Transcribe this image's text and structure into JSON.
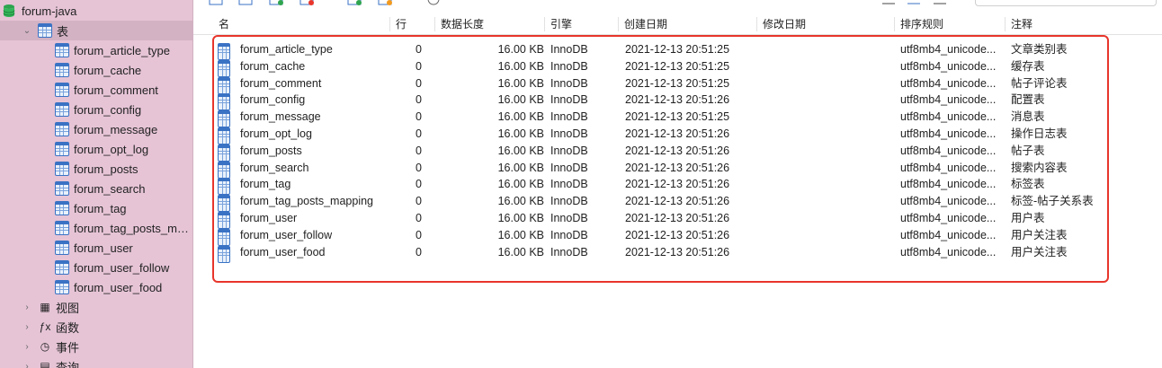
{
  "sidebar": {
    "database": "forum-java",
    "tables_group": "表",
    "tables": [
      "forum_article_type",
      "forum_cache",
      "forum_comment",
      "forum_config",
      "forum_message",
      "forum_opt_log",
      "forum_posts",
      "forum_search",
      "forum_tag",
      "forum_tag_posts_m…",
      "forum_user",
      "forum_user_follow",
      "forum_user_food"
    ],
    "categories": [
      {
        "label": "视图",
        "icon": "view-icon"
      },
      {
        "label": "函数",
        "icon": "function-icon"
      },
      {
        "label": "事件",
        "icon": "event-icon"
      },
      {
        "label": "查询",
        "icon": "query-icon"
      }
    ]
  },
  "table_header": {
    "name": "名",
    "rows": "行",
    "data_length": "数据长度",
    "engine": "引擎",
    "created": "创建日期",
    "modified": "修改日期",
    "collation": "排序规则",
    "comment": "注释"
  },
  "rows": [
    {
      "name": "forum_article_type",
      "rows": "0",
      "data_length": "16.00 KB",
      "engine": "InnoDB",
      "created": "2021-12-13 20:51:25",
      "collation": "utf8mb4_unicode...",
      "comment": "文章类别表"
    },
    {
      "name": "forum_cache",
      "rows": "0",
      "data_length": "16.00 KB",
      "engine": "InnoDB",
      "created": "2021-12-13 20:51:25",
      "collation": "utf8mb4_unicode...",
      "comment": "缓存表"
    },
    {
      "name": "forum_comment",
      "rows": "0",
      "data_length": "16.00 KB",
      "engine": "InnoDB",
      "created": "2021-12-13 20:51:25",
      "collation": "utf8mb4_unicode...",
      "comment": "帖子评论表"
    },
    {
      "name": "forum_config",
      "rows": "0",
      "data_length": "16.00 KB",
      "engine": "InnoDB",
      "created": "2021-12-13 20:51:26",
      "collation": "utf8mb4_unicode...",
      "comment": "配置表"
    },
    {
      "name": "forum_message",
      "rows": "0",
      "data_length": "16.00 KB",
      "engine": "InnoDB",
      "created": "2021-12-13 20:51:25",
      "collation": "utf8mb4_unicode...",
      "comment": "消息表"
    },
    {
      "name": "forum_opt_log",
      "rows": "0",
      "data_length": "16.00 KB",
      "engine": "InnoDB",
      "created": "2021-12-13 20:51:26",
      "collation": "utf8mb4_unicode...",
      "comment": "操作日志表"
    },
    {
      "name": "forum_posts",
      "rows": "0",
      "data_length": "16.00 KB",
      "engine": "InnoDB",
      "created": "2021-12-13 20:51:26",
      "collation": "utf8mb4_unicode...",
      "comment": "帖子表"
    },
    {
      "name": "forum_search",
      "rows": "0",
      "data_length": "16.00 KB",
      "engine": "InnoDB",
      "created": "2021-12-13 20:51:26",
      "collation": "utf8mb4_unicode...",
      "comment": "搜索内容表"
    },
    {
      "name": "forum_tag",
      "rows": "0",
      "data_length": "16.00 KB",
      "engine": "InnoDB",
      "created": "2021-12-13 20:51:26",
      "collation": "utf8mb4_unicode...",
      "comment": "标签表"
    },
    {
      "name": "forum_tag_posts_mapping",
      "rows": "0",
      "data_length": "16.00 KB",
      "engine": "InnoDB",
      "created": "2021-12-13 20:51:26",
      "collation": "utf8mb4_unicode...",
      "comment": "标签-帖子关系表"
    },
    {
      "name": "forum_user",
      "rows": "0",
      "data_length": "16.00 KB",
      "engine": "InnoDB",
      "created": "2021-12-13 20:51:26",
      "collation": "utf8mb4_unicode...",
      "comment": "用户表"
    },
    {
      "name": "forum_user_follow",
      "rows": "0",
      "data_length": "16.00 KB",
      "engine": "InnoDB",
      "created": "2021-12-13 20:51:26",
      "collation": "utf8mb4_unicode...",
      "comment": "用户关注表"
    },
    {
      "name": "forum_user_food",
      "rows": "0",
      "data_length": "16.00 KB",
      "engine": "InnoDB",
      "created": "2021-12-13 20:51:26",
      "collation": "utf8mb4_unicode...",
      "comment": "用户关注表"
    }
  ],
  "colors": {
    "sidebar_bg": "#e6c4d6",
    "selection_bg": "#d3b2c4",
    "highlight_border": "#e8352b",
    "table_icon": "#3a72c4"
  }
}
